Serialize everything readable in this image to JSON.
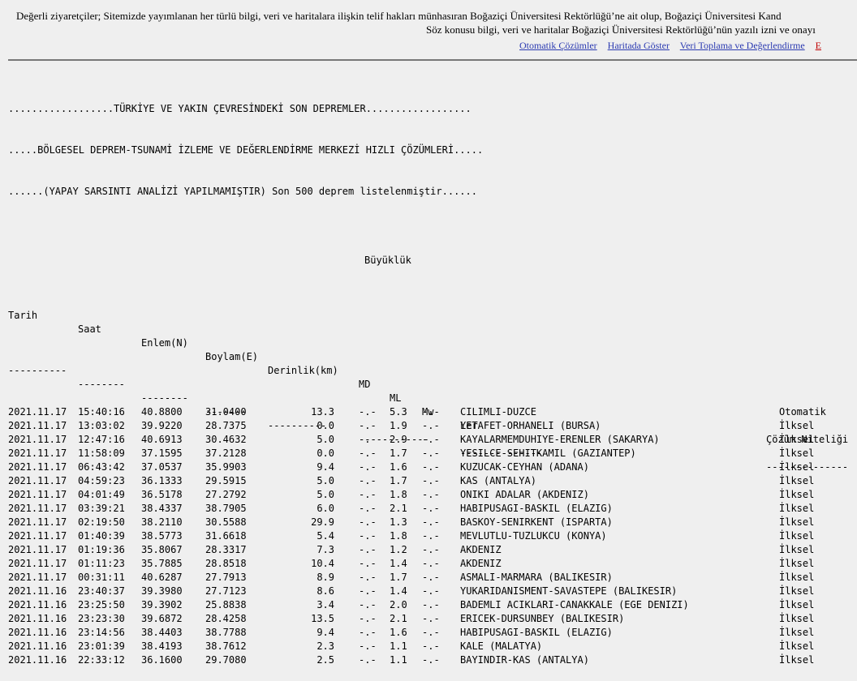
{
  "notice": {
    "line1": "Değerli ziyaretçiler; Sitemizde yayımlanan her türlü bilgi, veri ve haritalara ilişkin telif hakları münhasıran Boğaziçi Üniversitesi Rektörlüğü’ne ait olup, Boğaziçi Üniversitesi Kand",
    "line2": "Söz konusu bilgi, veri ve haritalar Boğaziçi Üniversitesi Rektörlüğü’nün yazılı izni ve onayı"
  },
  "nav": {
    "items": [
      "Otomatik Çözümler",
      "Haritada Göster",
      "Veri Toplama ve Değerlendirme",
      "E"
    ]
  },
  "header": {
    "line1": "..................TÜRKİYE VE YAKIN ÇEVRESİNDEKİ SON DEPREMLER..................",
    "line2": ".....BÖLGESEL DEPREM-TSUNAMİ İZLEME VE DEĞERLENDİRME MERKEZİ HIZLI ÇÖZÜMLERİ.....",
    "line3": "......(YAPAY SARSINTI ANALİZİ YAPILMAMIŞTIR) Son 500 deprem listelenmiştir......",
    "magnitude_label": "Büyüklük"
  },
  "columns": {
    "date": "Tarih",
    "time": "Saat",
    "lat": "Enlem(N)",
    "lon": "Boylam(E)",
    "depth": "Derinlik(km)",
    "md": "MD",
    "ml": "ML",
    "mw": "Mw",
    "place": "Yer",
    "quality": "Çözüm Niteliği"
  },
  "separators": {
    "date": "----------",
    "time": "--------",
    "lat": "--------",
    "lon": "-------",
    "depth": "----------",
    "mag": "------------",
    "place": "--------------",
    "quality": "--------------"
  },
  "rows": [
    {
      "date": "2021.11.17",
      "time": "15:40:16",
      "lat": "40.8800",
      "lon": "31.0400",
      "depth": "13.3",
      "md": "-.-",
      "ml": "5.3",
      "mw": "-.-",
      "place": "CILIMLI-DUZCE",
      "quality": "Otomatik"
    },
    {
      "date": "2021.11.17",
      "time": "13:03:02",
      "lat": "39.9220",
      "lon": "28.7375",
      "depth": "0.0",
      "md": "-.-",
      "ml": "1.9",
      "mw": "-.-",
      "place": "LETAFET-ORHANELI (BURSA)",
      "quality": "İlksel"
    },
    {
      "date": "2021.11.17",
      "time": "12:47:16",
      "lat": "40.6913",
      "lon": "30.4632",
      "depth": "5.0",
      "md": "-.-",
      "ml": "2.9",
      "mw": "-.-",
      "place": "KAYALARMEMDUHIYE-ERENLER (SAKARYA)",
      "quality": "İlksel"
    },
    {
      "date": "2021.11.17",
      "time": "11:58:09",
      "lat": "37.1595",
      "lon": "37.2128",
      "depth": "0.0",
      "md": "-.-",
      "ml": "1.7",
      "mw": "-.-",
      "place": "YESILCE-SEHITKAMIL (GAZIANTEP)",
      "quality": "İlksel"
    },
    {
      "date": "2021.11.17",
      "time": "06:43:42",
      "lat": "37.0537",
      "lon": "35.9903",
      "depth": "9.4",
      "md": "-.-",
      "ml": "1.6",
      "mw": "-.-",
      "place": "KUZUCAK-CEYHAN (ADANA)",
      "quality": "İlksel"
    },
    {
      "date": "2021.11.17",
      "time": "04:59:23",
      "lat": "36.1333",
      "lon": "29.5915",
      "depth": "5.0",
      "md": "-.-",
      "ml": "1.7",
      "mw": "-.-",
      "place": "KAS (ANTALYA)",
      "quality": "İlksel"
    },
    {
      "date": "2021.11.17",
      "time": "04:01:49",
      "lat": "36.5178",
      "lon": "27.2792",
      "depth": "5.0",
      "md": "-.-",
      "ml": "1.8",
      "mw": "-.-",
      "place": "ONIKI ADALAR (AKDENIZ)",
      "quality": "İlksel"
    },
    {
      "date": "2021.11.17",
      "time": "03:39:21",
      "lat": "38.4337",
      "lon": "38.7905",
      "depth": "6.0",
      "md": "-.-",
      "ml": "2.1",
      "mw": "-.-",
      "place": "HABIPUSAGI-BASKIL (ELAZIG)",
      "quality": "İlksel"
    },
    {
      "date": "2021.11.17",
      "time": "02:19:50",
      "lat": "38.2110",
      "lon": "30.5588",
      "depth": "29.9",
      "md": "-.-",
      "ml": "1.3",
      "mw": "-.-",
      "place": "BASKOY-SENIRKENT (ISPARTA)",
      "quality": "İlksel"
    },
    {
      "date": "2021.11.17",
      "time": "01:40:39",
      "lat": "38.5773",
      "lon": "31.6618",
      "depth": "5.4",
      "md": "-.-",
      "ml": "1.8",
      "mw": "-.-",
      "place": "MEVLUTLU-TUZLUKCU (KONYA)",
      "quality": "İlksel"
    },
    {
      "date": "2021.11.17",
      "time": "01:19:36",
      "lat": "35.8067",
      "lon": "28.3317",
      "depth": "7.3",
      "md": "-.-",
      "ml": "1.2",
      "mw": "-.-",
      "place": "AKDENIZ",
      "quality": "İlksel"
    },
    {
      "date": "2021.11.17",
      "time": "01:11:23",
      "lat": "35.7885",
      "lon": "28.8518",
      "depth": "10.4",
      "md": "-.-",
      "ml": "1.4",
      "mw": "-.-",
      "place": "AKDENIZ",
      "quality": "İlksel"
    },
    {
      "date": "2021.11.17",
      "time": "00:31:11",
      "lat": "40.6287",
      "lon": "27.7913",
      "depth": "8.9",
      "md": "-.-",
      "ml": "1.7",
      "mw": "-.-",
      "place": "ASMALI-MARMARA (BALIKESIR)",
      "quality": "İlksel"
    },
    {
      "date": "2021.11.16",
      "time": "23:40:37",
      "lat": "39.3980",
      "lon": "27.7123",
      "depth": "8.6",
      "md": "-.-",
      "ml": "1.4",
      "mw": "-.-",
      "place": "YUKARIDANISMENT-SAVASTEPE (BALIKESIR)",
      "quality": "İlksel"
    },
    {
      "date": "2021.11.16",
      "time": "23:25:50",
      "lat": "39.3902",
      "lon": "25.8838",
      "depth": "3.4",
      "md": "-.-",
      "ml": "2.0",
      "mw": "-.-",
      "place": "BADEMLI ACIKLARI-CANAKKALE (EGE DENIZI)",
      "quality": "İlksel"
    },
    {
      "date": "2021.11.16",
      "time": "23:23:30",
      "lat": "39.6872",
      "lon": "28.4258",
      "depth": "13.5",
      "md": "-.-",
      "ml": "2.1",
      "mw": "-.-",
      "place": "ERICEK-DURSUNBEY (BALIKESIR)",
      "quality": "İlksel"
    },
    {
      "date": "2021.11.16",
      "time": "23:14:56",
      "lat": "38.4403",
      "lon": "38.7788",
      "depth": "9.4",
      "md": "-.-",
      "ml": "1.6",
      "mw": "-.-",
      "place": "HABIPUSAGI-BASKIL (ELAZIG)",
      "quality": "İlksel"
    },
    {
      "date": "2021.11.16",
      "time": "23:01:39",
      "lat": "38.4193",
      "lon": "38.7612",
      "depth": "2.3",
      "md": "-.-",
      "ml": "1.1",
      "mw": "-.-",
      "place": "KALE (MALATYA)",
      "quality": "İlksel"
    },
    {
      "date": "2021.11.16",
      "time": "22:33:12",
      "lat": "36.1600",
      "lon": "29.7080",
      "depth": "2.5",
      "md": "-.-",
      "ml": "1.1",
      "mw": "-.-",
      "place": "BAYINDIR-KAS (ANTALYA)",
      "quality": "İlksel"
    }
  ]
}
